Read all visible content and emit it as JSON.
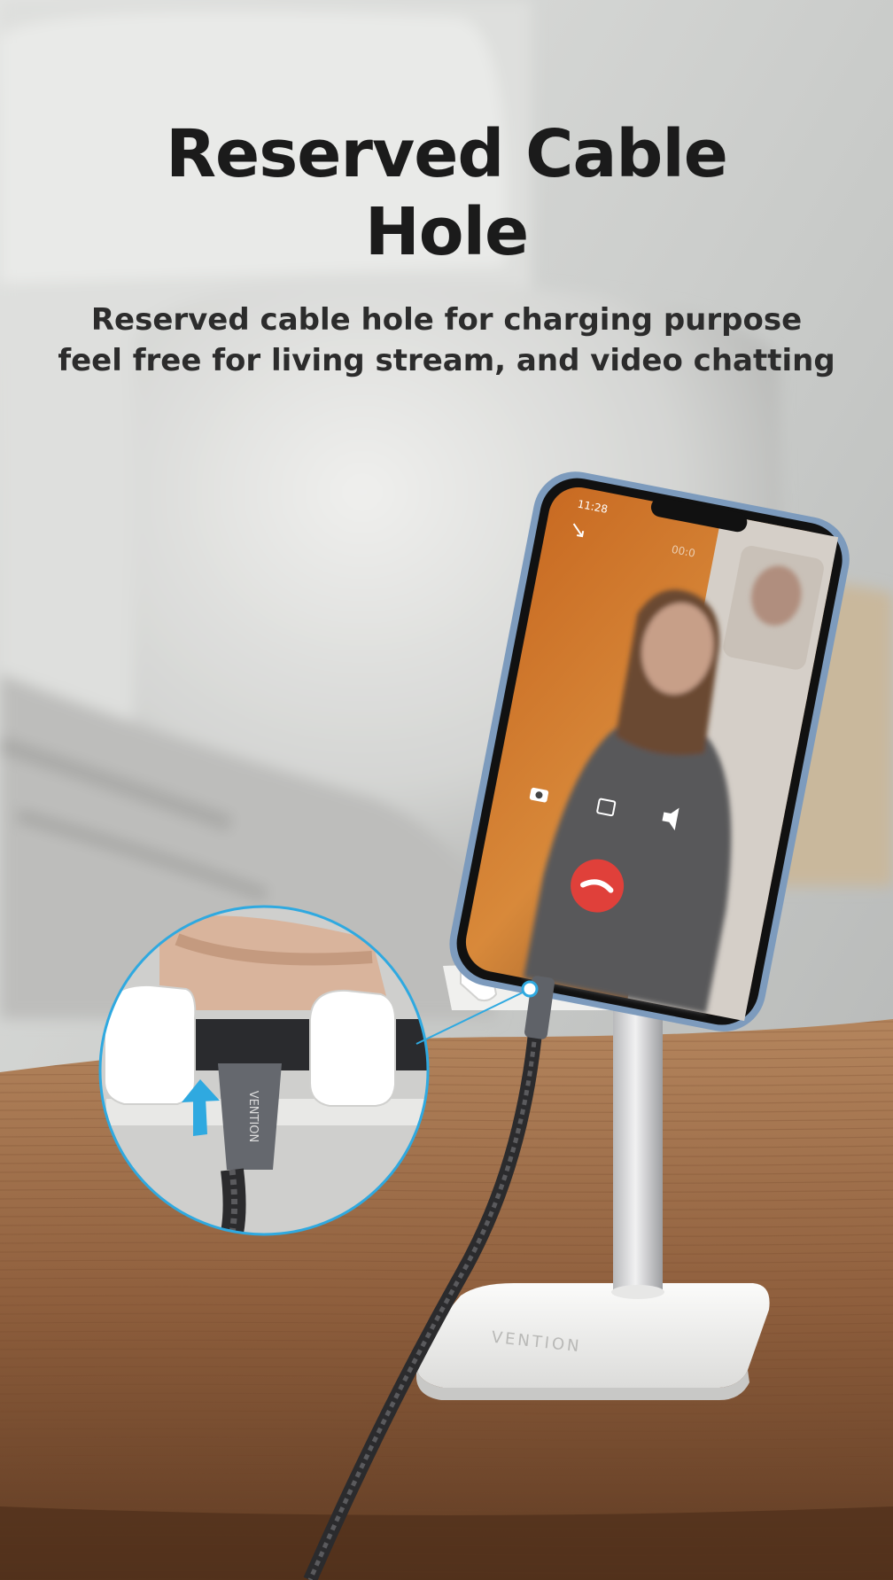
{
  "headline": {
    "line1": "Reserved Cable",
    "line2": "Hole"
  },
  "subtitle": {
    "line1": "Reserved cable hole for charging purpose",
    "line2": "feel free for living stream, and video chatting"
  },
  "phone_screen": {
    "status_time": "11:28",
    "call_timer": "00:0"
  },
  "brand": {
    "stand_logo": "VENTION",
    "cable_logo": "VENTION"
  },
  "colors": {
    "wall": "#c9cbc9",
    "sofa": "#e4e4e2",
    "table_wood": "#9a6a45",
    "accent_blue": "#2fa9e0",
    "end_call_red": "#e0403a",
    "stand_white": "#f3f3f1"
  },
  "icons": [
    "camera-icon",
    "switch-camera-icon",
    "speaker-icon",
    "end-call-icon",
    "minimize-icon",
    "upward-arrow-icon"
  ]
}
